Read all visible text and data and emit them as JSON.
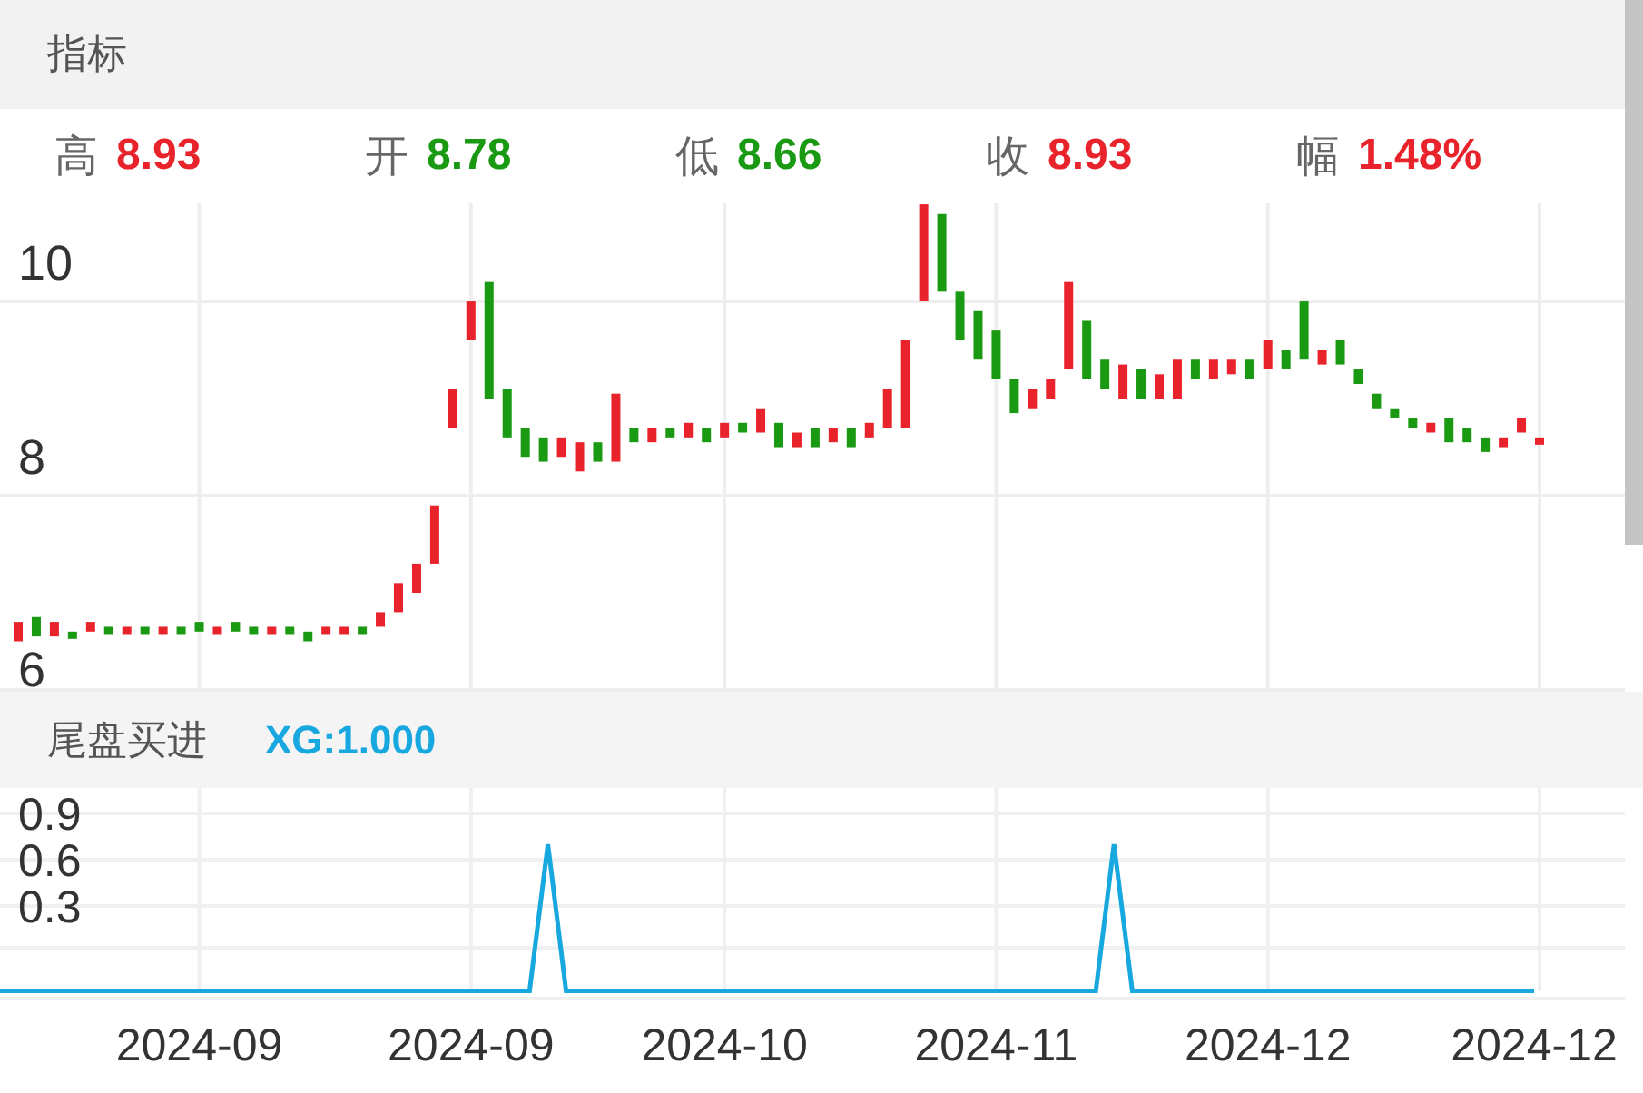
{
  "header": {
    "title": "指标"
  },
  "stats": [
    {
      "label": "高",
      "value": "8.93",
      "color": "#e8232b"
    },
    {
      "label": "开",
      "value": "8.78",
      "color": "#1a9a12"
    },
    {
      "label": "低",
      "value": "8.66",
      "color": "#1a9a12"
    },
    {
      "label": "收",
      "value": "8.93",
      "color": "#e8232b"
    },
    {
      "label": "幅",
      "value": "1.48%",
      "color": "#e8232b"
    }
  ],
  "price_chart": {
    "y_labels": [
      "10",
      "8",
      "6"
    ]
  },
  "indicator": {
    "name": "尾盘买进",
    "reading": "XG:1.000"
  },
  "date_labels": [
    "2024-09",
    "2024-09",
    "2024-10",
    "2024-11",
    "2024-12",
    "2024-12"
  ],
  "signal_chart": {
    "chart_data": {
      "type": "line",
      "grid": true,
      "ylim": [
        -0.3,
        0.9
      ],
      "yticks": [
        0.3,
        0.6,
        0.9
      ],
      "series": [
        {
          "color": "#18a8e0",
          "values": [
            -0.25,
            -0.25,
            -0.25,
            -0.25,
            -0.25,
            -0.25,
            -0.25,
            -0.25,
            -0.25,
            -0.25,
            -0.25,
            -0.25,
            -0.25,
            -0.25,
            -0.25,
            -0.25,
            -0.25,
            -0.25,
            -0.25,
            -0.25,
            -0.25,
            -0.25,
            -0.25,
            -0.25,
            -0.25,
            -0.25,
            -0.25,
            -0.25,
            -0.25,
            -0.25,
            0.7,
            -0.25,
            -0.25,
            -0.25,
            -0.25,
            -0.25,
            -0.25,
            -0.25,
            -0.25,
            -0.25,
            -0.25,
            -0.25,
            -0.25,
            -0.25,
            -0.25,
            -0.25,
            -0.25,
            -0.25,
            -0.25,
            -0.25,
            -0.25,
            -0.25,
            -0.25,
            -0.25,
            -0.25,
            -0.25,
            -0.25,
            -0.25,
            -0.25,
            -0.25,
            -0.25,
            0.7,
            -0.25,
            -0.25,
            -0.25,
            -0.25,
            -0.25,
            -0.25,
            -0.25,
            -0.25,
            -0.25,
            -0.25,
            -0.25,
            -0.25,
            -0.25,
            -0.25,
            -0.25,
            -0.25,
            -0.25,
            -0.25,
            -0.25,
            -0.25,
            -0.25,
            -0.25,
            -0.25
          ]
        }
      ]
    }
  }
}
